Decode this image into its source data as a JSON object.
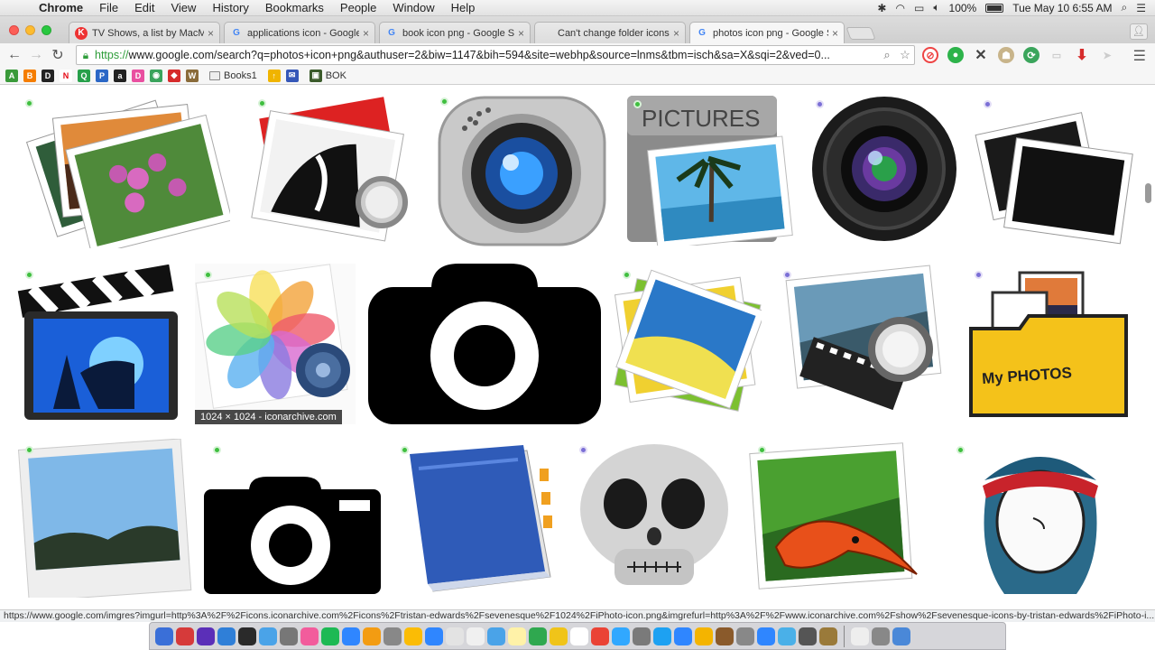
{
  "menubar": {
    "app_name": "Chrome",
    "items": [
      "File",
      "Edit",
      "View",
      "History",
      "Bookmarks",
      "People",
      "Window",
      "Help"
    ],
    "battery": "100%",
    "datetime": "Tue May 10  6:55 AM"
  },
  "tabs": [
    {
      "title": "TV Shows, a list by MacMag",
      "fav_color": "#e33",
      "fav_glyph": "K",
      "active": false
    },
    {
      "title": "applications icon - Google S",
      "fav_color": "#4285f4",
      "fav_glyph": "G",
      "active": false
    },
    {
      "title": "book icon png - Google Se",
      "fav_color": "#4285f4",
      "fav_glyph": "G",
      "active": false
    },
    {
      "title": "Can't change folder icons |",
      "fav_color": "#555",
      "fav_glyph": "",
      "active": false
    },
    {
      "title": "photos icon png - Google S",
      "fav_color": "#4285f4",
      "fav_glyph": "G",
      "active": true
    }
  ],
  "toolbar": {
    "url_scheme": "https://",
    "url_rest": "www.google.com/search?q=photos+icon+png&authuser=2&biw=1147&bih=594&site=webhp&source=lnms&tbm=isch&sa=X&sqi=2&ved=0..."
  },
  "bookmarks": {
    "folders": [
      "Books1",
      "BOK"
    ],
    "icons": [
      {
        "name": "bookmark-green-a",
        "color": "#3a9a3a",
        "glyph": "A"
      },
      {
        "name": "bookmark-blogger",
        "color": "#f57d00",
        "glyph": "B"
      },
      {
        "name": "bookmark-dark",
        "color": "#222",
        "glyph": "D"
      },
      {
        "name": "bookmark-netflix",
        "color": "#fff",
        "glyph": "N",
        "text_color": "#e50914"
      },
      {
        "name": "bookmark-green-q",
        "color": "#27a04a",
        "glyph": "Q"
      },
      {
        "name": "bookmark-p",
        "color": "#2b67c6",
        "glyph": "P"
      },
      {
        "name": "bookmark-amazon",
        "color": "#222",
        "glyph": "a"
      },
      {
        "name": "bookmark-d",
        "color": "#e94fa0",
        "glyph": "D"
      },
      {
        "name": "bookmark-owl",
        "color": "#3aa35c",
        "glyph": "◉"
      },
      {
        "name": "bookmark-red",
        "color": "#d62b2b",
        "glyph": "◆"
      },
      {
        "name": "bookmark-brown",
        "color": "#8a6b3a",
        "glyph": "W"
      }
    ],
    "after_folder_icons": [
      {
        "name": "bookmark-hand",
        "color": "#f0b400",
        "glyph": "↑"
      },
      {
        "name": "bookmark-mail",
        "color": "#3557b8",
        "glyph": "✉"
      }
    ]
  },
  "images": [
    {
      "name": "photo-stack-orchid",
      "dot": "green"
    },
    {
      "name": "photo-stack-woman-magnifier",
      "dot": "green"
    },
    {
      "name": "webcam-lens",
      "dot": "green"
    },
    {
      "name": "pictures-folder",
      "dot": "green",
      "label": "PICTURES"
    },
    {
      "name": "aperture-lens",
      "dot": "purple"
    },
    {
      "name": "blank-photo-frames",
      "dot": "purple"
    },
    {
      "name": "imovie-clapboard",
      "dot": "green"
    },
    {
      "name": "ios-photos-flower",
      "dot": "green",
      "caption": "1024 × 1024 - iconarchive.com"
    },
    {
      "name": "camera-black-large",
      "dot": "none"
    },
    {
      "name": "photo-stack-landscape",
      "dot": "green"
    },
    {
      "name": "preview-film-magnifier",
      "dot": "purple"
    },
    {
      "name": "my-photos-folder",
      "dot": "purple",
      "label": "My PHOTOS"
    },
    {
      "name": "polaroid-sky",
      "dot": "green"
    },
    {
      "name": "camera-black-small",
      "dot": "green"
    },
    {
      "name": "blue-book",
      "dot": "green"
    },
    {
      "name": "skull",
      "dot": "purple"
    },
    {
      "name": "salamander-photo",
      "dot": "green"
    },
    {
      "name": "bandana-girl",
      "dot": "green"
    }
  ],
  "status_url": "https://www.google.com/imgres?imgurl=http%3A%2F%2Ficons.iconarchive.com%2Ficons%2Ftristan-edwards%2Fsevenesque%2F1024%2FiPhoto-icon.png&imgrefurl=http%3A%2F%2Fwww.iconarchive.com%2Fshow%2Fsevenesque-icons-by-tristan-edwards%2FiPhoto-i...",
  "dock": {
    "icons": [
      "#3a6fd8",
      "#d63a3a",
      "#5b2fb8",
      "#2f7fd8",
      "#2a2a2a",
      "#4aa3e8",
      "#777",
      "#f25c9c",
      "#1db954",
      "#2f86ff",
      "#f39c12",
      "#888",
      "#fbbc05",
      "#2f86ff",
      "#e3e3e3",
      "#f0f0f0",
      "#4aa3e8",
      "#fff2a8",
      "#2fa84f",
      "#f0c419",
      "#ffffff",
      "#ea4335",
      "#31a8ff",
      "#7a7a7a",
      "#1da1f2",
      "#2f86ff",
      "#f4b400",
      "#8a5a2b",
      "#888",
      "#2f86ff",
      "#4ab0e8",
      "#555",
      "#9a7a3a",
      "#eee",
      "#888",
      "#4a88d8"
    ]
  }
}
